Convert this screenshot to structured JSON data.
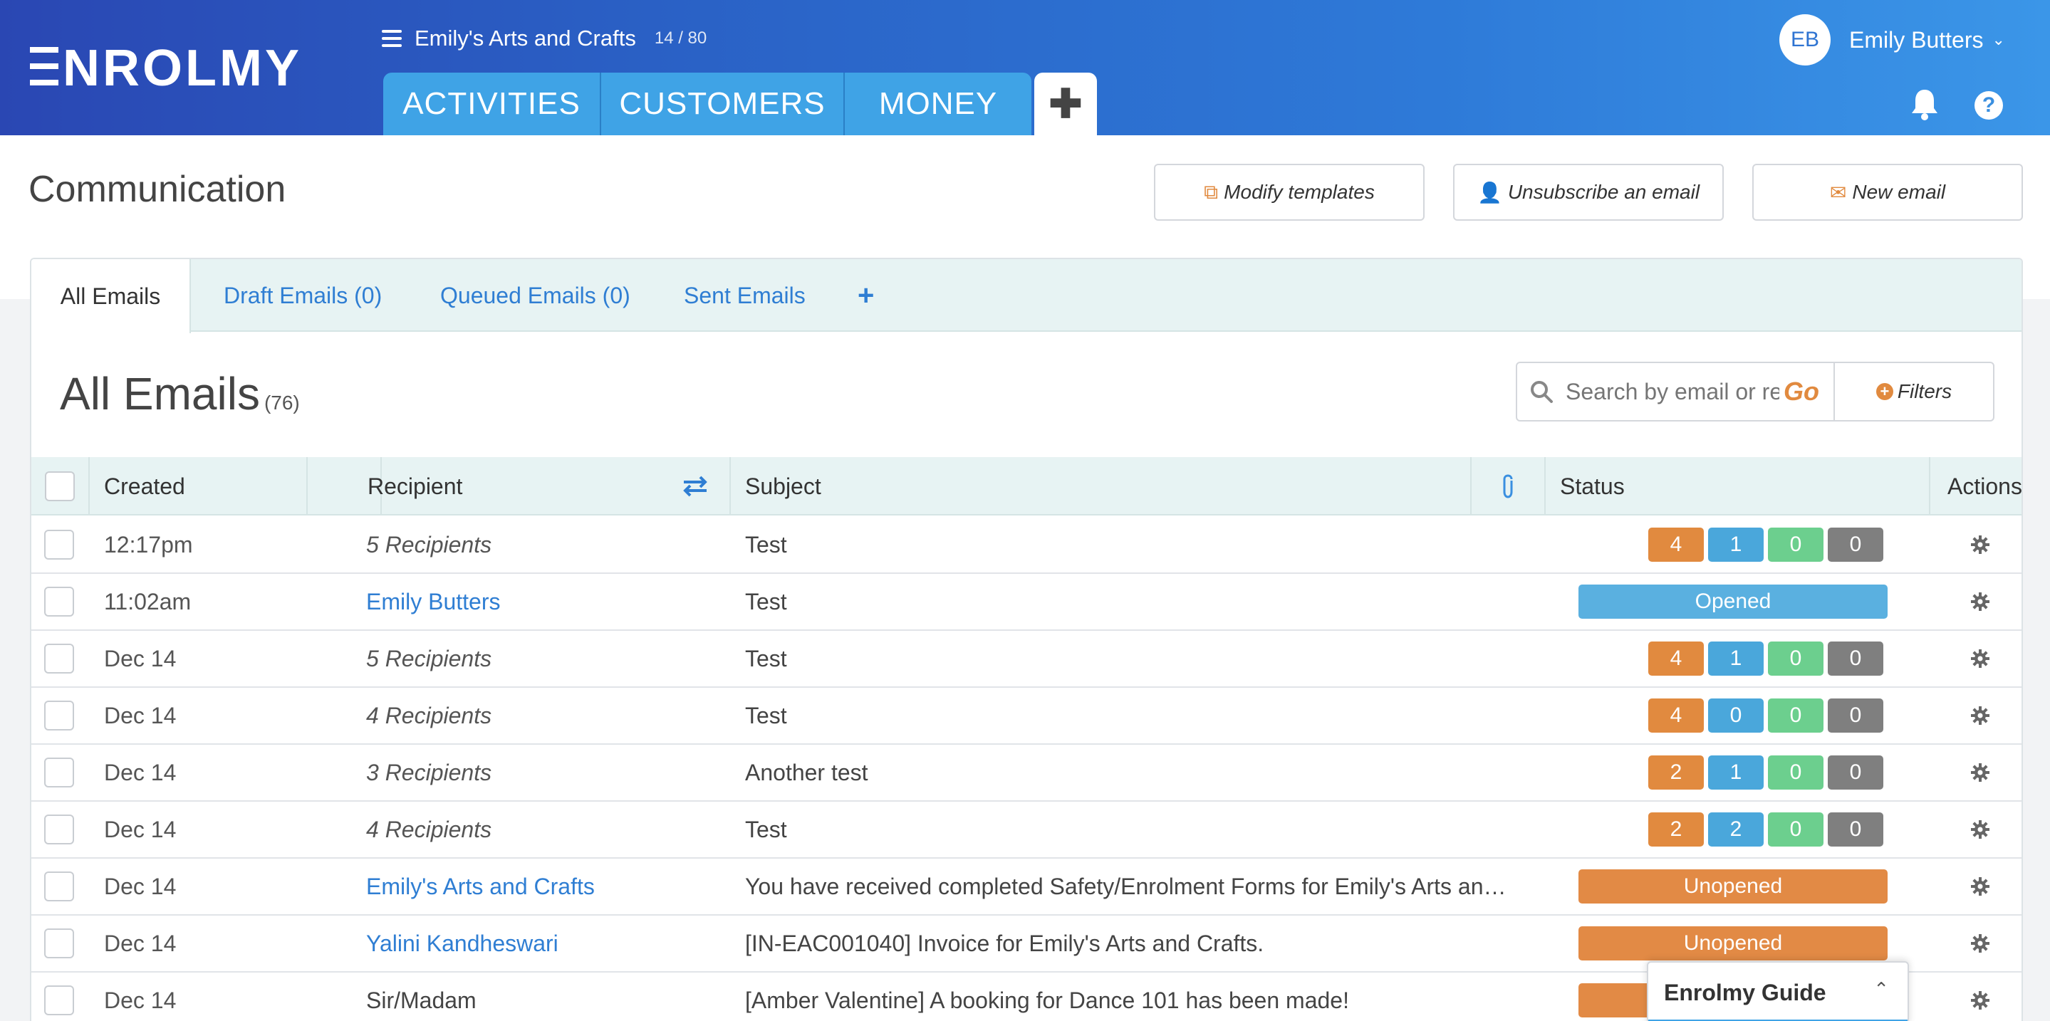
{
  "header": {
    "brand": "ENROLMY",
    "org_name": "Emily's Arts and Crafts",
    "org_count": "14 / 80",
    "nav": [
      {
        "label": "ACTIVITIES"
      },
      {
        "label": "CUSTOMERS"
      },
      {
        "label": "MONEY"
      }
    ],
    "user": {
      "initials": "EB",
      "name": "Emily Butters"
    },
    "help_label": "?"
  },
  "page": {
    "title": "Communication",
    "buttons": {
      "modify_templates": "Modify templates",
      "unsubscribe": "Unsubscribe an email",
      "new_email": "New email"
    }
  },
  "tabs": [
    {
      "label": "All Emails",
      "active": true
    },
    {
      "label": "Draft Emails (0)"
    },
    {
      "label": "Queued Emails (0)"
    },
    {
      "label": "Sent Emails"
    }
  ],
  "list": {
    "title": "All Emails",
    "count": "(76)",
    "search_placeholder": "Search by email or recipient",
    "go_label": "Go",
    "filters_label": "Filters"
  },
  "table": {
    "columns": {
      "created": "Created",
      "recipient": "Recipient",
      "subject": "Subject",
      "status": "Status",
      "actions": "Actions"
    },
    "rows": [
      {
        "created": "12:17pm",
        "recipient": "5 Recipients",
        "recipient_style": "italic",
        "subject": "Test",
        "status": {
          "type": "counts",
          "values": [
            "4",
            "1",
            "0",
            "0"
          ]
        }
      },
      {
        "created": "11:02am",
        "recipient": "Emily Butters",
        "recipient_style": "link",
        "subject": "Test",
        "status": {
          "type": "pill",
          "label": "Opened"
        }
      },
      {
        "created": "Dec 14",
        "recipient": "5 Recipients",
        "recipient_style": "italic",
        "subject": "Test",
        "status": {
          "type": "counts",
          "values": [
            "4",
            "1",
            "0",
            "0"
          ]
        }
      },
      {
        "created": "Dec 14",
        "recipient": "4 Recipients",
        "recipient_style": "italic",
        "subject": "Test",
        "status": {
          "type": "counts",
          "values": [
            "4",
            "0",
            "0",
            "0"
          ]
        }
      },
      {
        "created": "Dec 14",
        "recipient": "3 Recipients",
        "recipient_style": "italic",
        "subject": "Another test",
        "status": {
          "type": "counts",
          "values": [
            "2",
            "1",
            "0",
            "0"
          ]
        }
      },
      {
        "created": "Dec 14",
        "recipient": "4 Recipients",
        "recipient_style": "italic",
        "subject": "Test",
        "status": {
          "type": "counts",
          "values": [
            "2",
            "2",
            "0",
            "0"
          ]
        }
      },
      {
        "created": "Dec 14",
        "recipient": "Emily's Arts and Crafts",
        "recipient_style": "link",
        "subject": "You have received completed Safety/Enrolment Forms for Emily's Arts an…",
        "status": {
          "type": "pill",
          "label": "Unopened"
        }
      },
      {
        "created": "Dec 14",
        "recipient": "Yalini Kandheswari",
        "recipient_style": "link",
        "subject": "[IN-EAC001040] Invoice for Emily's Arts and Crafts.",
        "status": {
          "type": "pill",
          "label": "Unopened"
        }
      },
      {
        "created": "Dec 14",
        "recipient": "Sir/Madam",
        "recipient_style": "plain",
        "subject": "[Amber Valentine] A booking for Dance 101 has been made!",
        "status": {
          "type": "pill",
          "label": "Unopened"
        }
      }
    ]
  },
  "guide": {
    "title": "Enrolmy Guide"
  },
  "colors": {
    "orange": "#e18a3f",
    "blue": "#4aa7db",
    "green": "#6ccf8e",
    "gray": "#7f7f7f",
    "opened": "#5ab0e0",
    "unopened": "#e28a45"
  },
  "icons": [
    "hamburger-icon",
    "plus-icon",
    "bell-icon",
    "help-icon",
    "chevron-down-icon",
    "copy-icon",
    "user-x-icon",
    "envelope-icon",
    "search-icon",
    "plus-circle-icon",
    "swap-icon",
    "paperclip-icon",
    "gear-icon",
    "chevron-up-icon"
  ]
}
